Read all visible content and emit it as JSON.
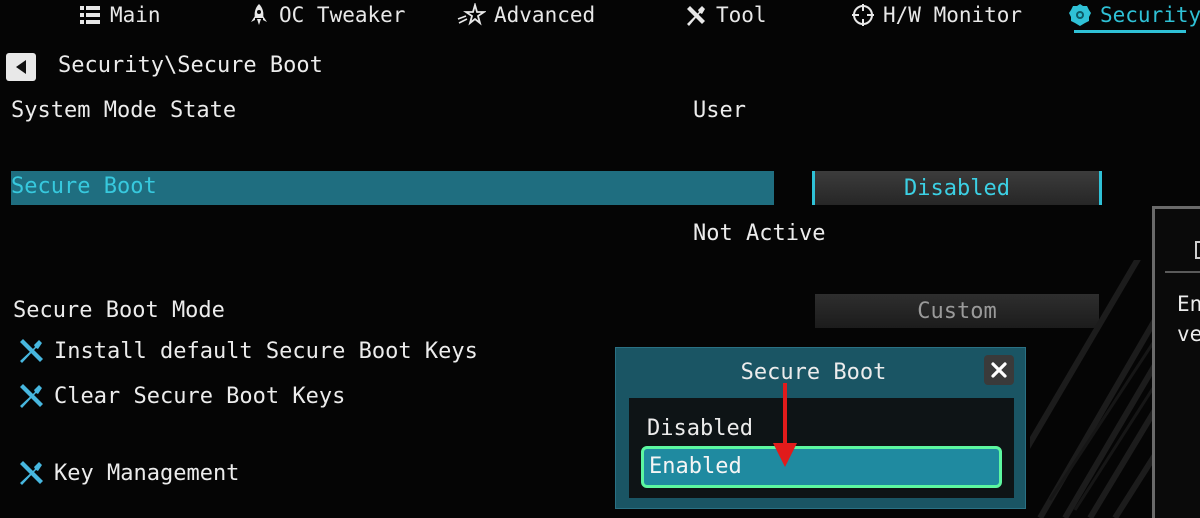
{
  "nav": {
    "tabs": [
      {
        "label": "Main",
        "icon": "list-icon"
      },
      {
        "label": "OC Tweaker",
        "icon": "rocket-icon"
      },
      {
        "label": "Advanced",
        "icon": "star-icon"
      },
      {
        "label": "Tool",
        "icon": "tools-icon"
      },
      {
        "label": "H/W Monitor",
        "icon": "crosshair-icon"
      },
      {
        "label": "Security",
        "icon": "shield-icon",
        "active": true
      }
    ]
  },
  "breadcrumb": "Security\\Secure Boot",
  "settings": {
    "system_mode_state": {
      "label": "System Mode State",
      "value": "User"
    },
    "secure_boot": {
      "label": "Secure Boot",
      "value": "Disabled",
      "status": "Not Active"
    },
    "secure_boot_mode": {
      "label": "Secure Boot Mode",
      "value": "Custom"
    }
  },
  "tools": {
    "install_default_keys": "Install default Secure Boot Keys",
    "clear_keys": "Clear Secure Boot Keys",
    "key_management": "Key Management"
  },
  "help_panel": {
    "text_line1": "En",
    "text_line2": "ve"
  },
  "popup": {
    "title": "Secure Boot",
    "options": [
      "Disabled",
      "Enabled"
    ],
    "selected": "Enabled"
  },
  "colors": {
    "accent": "#2fc1d6",
    "highlight_row": "#1f6e80",
    "popup_selected_border": "#5cf7a0",
    "annotation_arrow": "#e11b1b"
  }
}
